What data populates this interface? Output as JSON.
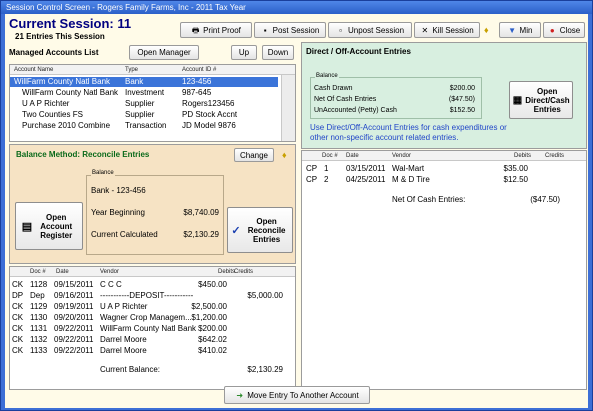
{
  "window": {
    "title": "Session Control Screen - Rogers Family Farms, Inc - 2011 Tax Year"
  },
  "session": {
    "title": "Current Session: 11",
    "entries": "21 Entries This Session"
  },
  "toolbar": {
    "print_proof": "Print Proof",
    "post_session": "Post Session",
    "unpost_session": "Unpost Session",
    "kill_session": "Kill Session",
    "min": "Min",
    "close": "Close"
  },
  "accounts": {
    "title": "Managed Accounts List",
    "open_manager": "Open Manager",
    "up": "Up",
    "down": "Down",
    "columns": [
      "Account Name",
      "Type",
      "Account ID #"
    ],
    "rows": [
      [
        "WillFarm County Natl Bank",
        "Bank",
        "123-456"
      ],
      [
        "WillFarm County Natl Bank",
        "Investment",
        "987-645"
      ],
      [
        "U A P Richter",
        "Supplier",
        "Rogers123456"
      ],
      [
        "Two Counties FS",
        "Supplier",
        "PD Stock Accnt"
      ],
      [
        "Purchase 2010 Combine",
        "Transaction",
        "JD Model 9876"
      ]
    ]
  },
  "balance": {
    "title": "Balance Method: Reconcile Entries",
    "change": "Change",
    "group_label": "Balance",
    "account": "Bank - 123-456",
    "year_beginning_label": "Year Beginning",
    "year_beginning_value": "$8,740.09",
    "current_label": "Current Calculated",
    "current_value": "$2,130.29",
    "open_register": "Open Account Register",
    "open_reconcile": "Open Reconcile Entries"
  },
  "register": {
    "columns": [
      "Doc #",
      "Date",
      "Vendor",
      "Debits",
      "Credits"
    ],
    "rows": [
      [
        "CK",
        "1128",
        "09/15/2011",
        "C C C",
        "$450.00",
        ""
      ],
      [
        "DP",
        "Dep",
        "09/16/2011",
        "-----------DEPOSIT-----------",
        "",
        "$5,000.00"
      ],
      [
        "CK",
        "1129",
        "09/19/2011",
        "U A P Richter",
        "$2,500.00",
        ""
      ],
      [
        "CK",
        "1130",
        "09/20/2011",
        "Wagner Crop Managem...",
        "$1,200.00",
        ""
      ],
      [
        "CK",
        "1131",
        "09/22/2011",
        "WillFarm County Natl Bank",
        "$200.00",
        ""
      ],
      [
        "CK",
        "1132",
        "09/22/2011",
        "Darrel Moore",
        "$642.02",
        ""
      ],
      [
        "CK",
        "1133",
        "09/22/2011",
        "Darrel Moore",
        "$410.02",
        ""
      ]
    ],
    "current_balance_label": "Current Balance:",
    "current_balance_value": "$2,130.29"
  },
  "direct": {
    "title": "Direct / Off-Account Entries",
    "group_label": "Balance",
    "cash_drawn_label": "Cash Drawn",
    "cash_drawn_value": "$200.00",
    "net_cash_label": "Net Of Cash Entries",
    "net_cash_value": "($47.50)",
    "unaccounted_label": "UnAccounted (Petty) Cash",
    "unaccounted_value": "$152.50",
    "open_button": "Open Direct/Cash Entries",
    "note": "Use Direct/Off-Account Entries for cash expenditures or other non-specific account related entries.",
    "columns": [
      "Doc #",
      "Date",
      "Vendor",
      "Debits",
      "Credits"
    ],
    "rows": [
      [
        "CP",
        "1",
        "03/15/2011",
        "Wal-Mart",
        "$35.00",
        ""
      ],
      [
        "CP",
        "2",
        "04/25/2011",
        "M & D Tire",
        "$12.50",
        ""
      ]
    ],
    "net_label": "Net Of Cash Entries:",
    "net_value": "($47.50)"
  },
  "footer": {
    "move_entry": "Move Entry To Another Account"
  },
  "colors": {
    "title_blue": "#000080",
    "selected_row": "#3b74d9",
    "note_blue": "#2045c8",
    "balance_panel": "#f6e3c4",
    "direct_panel": "#d8efe0"
  }
}
